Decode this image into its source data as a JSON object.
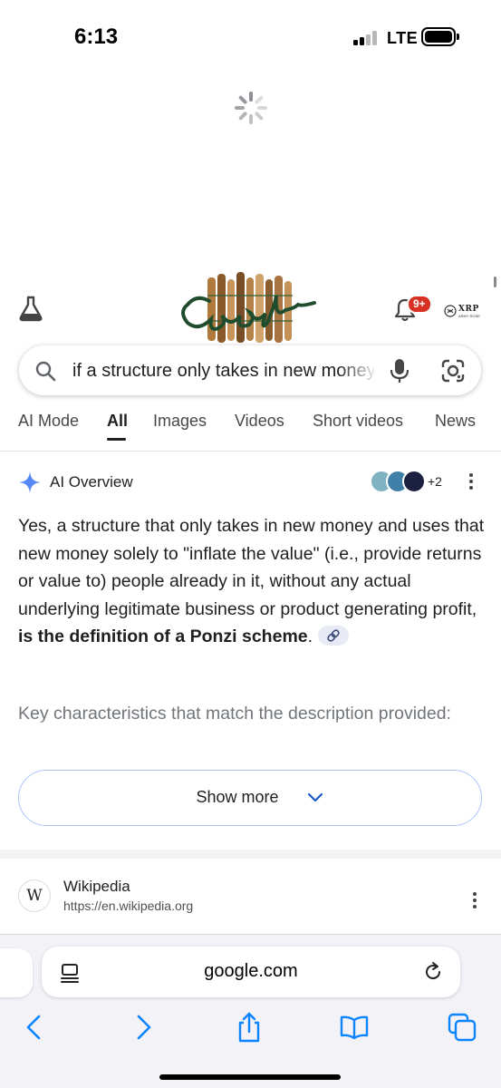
{
  "status_bar": {
    "time": "6:13",
    "network": "LTE"
  },
  "header": {
    "labs_icon": "flask-icon",
    "doodle_alt": "Google",
    "notification_badge": "9+",
    "avatar_text": "XRP",
    "avatar_sub": "ARMY ROSE"
  },
  "search": {
    "query": "if a structure only takes in new money to inflate the value"
  },
  "tabs": [
    {
      "label": "AI Mode",
      "active": false
    },
    {
      "label": "All",
      "active": true
    },
    {
      "label": "Images",
      "active": false
    },
    {
      "label": "Videos",
      "active": false
    },
    {
      "label": "Short videos",
      "active": false
    },
    {
      "label": "News",
      "active": false
    }
  ],
  "ai_overview": {
    "title": "AI Overview",
    "sources_more": "+2",
    "body_plain": "Yes, a structure that only takes in new money and uses that new money solely to \"inflate the value\" (i.e., provide returns or value to) people already in it, without any actual underlying legitimate business or product generating profit, ",
    "body_bold": "is the definition of a Ponzi scheme",
    "body_end": ".",
    "key_characteristics": "Key characteristics that match the description provided:",
    "show_more": "Show more"
  },
  "result": {
    "site_name": "Wikipedia",
    "url": "https://en.wikipedia.org",
    "favicon_letter": "W"
  },
  "safari": {
    "url": "google.com"
  },
  "colors": {
    "accent_blue": "#4285f4",
    "badge_red": "#d93025",
    "safari_blue": "#0a84ff",
    "show_more_border": "#a8c7fa"
  }
}
